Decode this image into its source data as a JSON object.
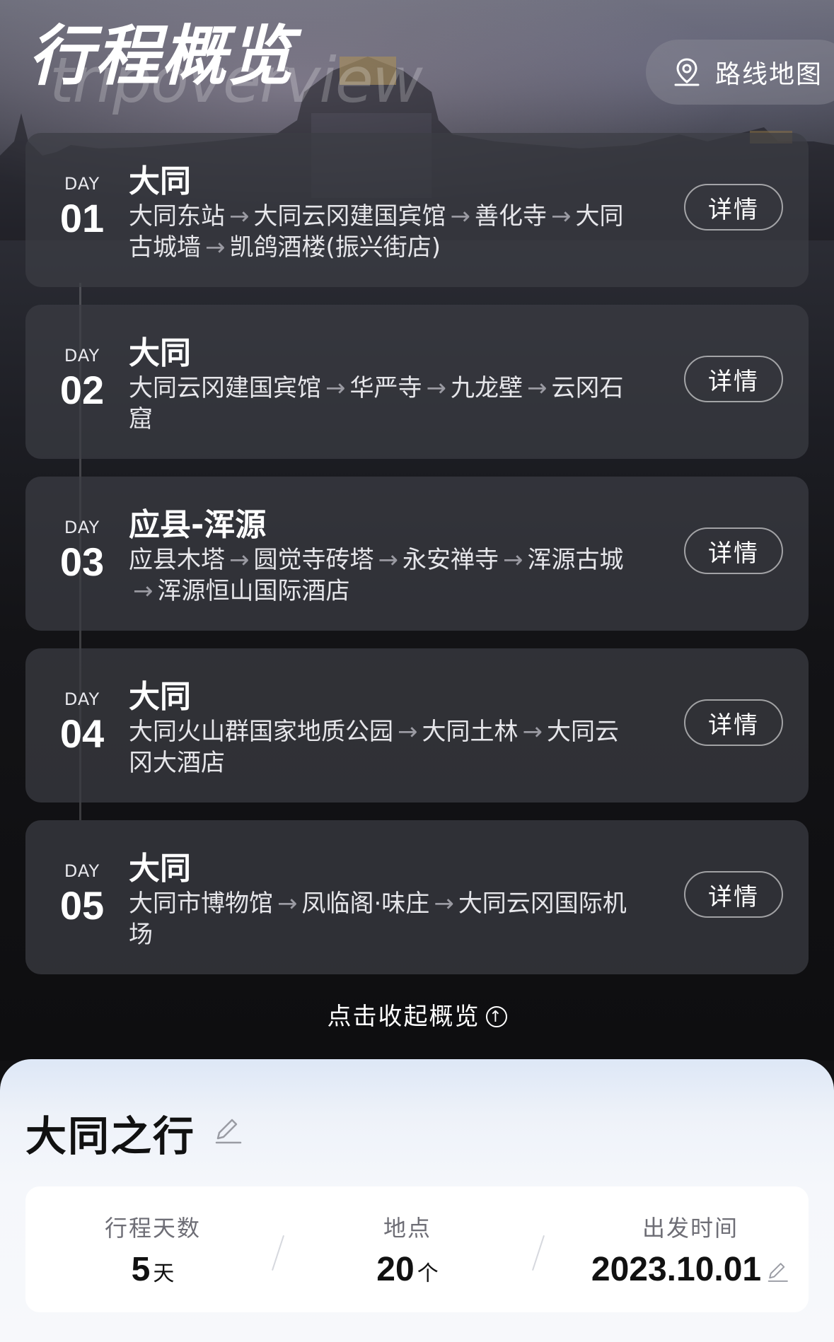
{
  "header": {
    "title": "行程概览",
    "subtitle": "tripoverview",
    "map_button_label": "路线地图",
    "map_icon": "map-pin-icon"
  },
  "days": [
    {
      "day_word": "DAY",
      "day_num": "01",
      "city": "大同",
      "stops": [
        "大同东站",
        "大同云冈建国宾馆",
        "善化寺",
        "大同古城墙",
        "凯鸽酒楼(振兴街店)"
      ],
      "detail_label": "详情"
    },
    {
      "day_word": "DAY",
      "day_num": "02",
      "city": "大同",
      "stops": [
        "大同云冈建国宾馆",
        "华严寺",
        "九龙壁",
        "云冈石窟"
      ],
      "detail_label": "详情"
    },
    {
      "day_word": "DAY",
      "day_num": "03",
      "city": "应县-浑源",
      "stops": [
        "应县木塔",
        "圆觉寺砖塔",
        "永安禅寺",
        "浑源古城",
        "浑源恒山国际酒店"
      ],
      "detail_label": "详情"
    },
    {
      "day_word": "DAY",
      "day_num": "04",
      "city": "大同",
      "stops": [
        "大同火山群国家地质公园",
        "大同土林",
        "大同云冈大酒店"
      ],
      "detail_label": "详情"
    },
    {
      "day_word": "DAY",
      "day_num": "05",
      "city": "大同",
      "stops": [
        "大同市博物馆",
        "凤临阁·味庄",
        "大同云冈国际机场"
      ],
      "detail_label": "详情"
    }
  ],
  "arrow": "→",
  "collapse_label": "点击收起概览",
  "trip": {
    "title": "大同之行",
    "stats": [
      {
        "label": "行程天数",
        "value": "5",
        "unit": "天"
      },
      {
        "label": "地点",
        "value": "20",
        "unit": "个"
      },
      {
        "label": "出发时间",
        "value": "2023.10.01",
        "unit": ""
      }
    ]
  }
}
